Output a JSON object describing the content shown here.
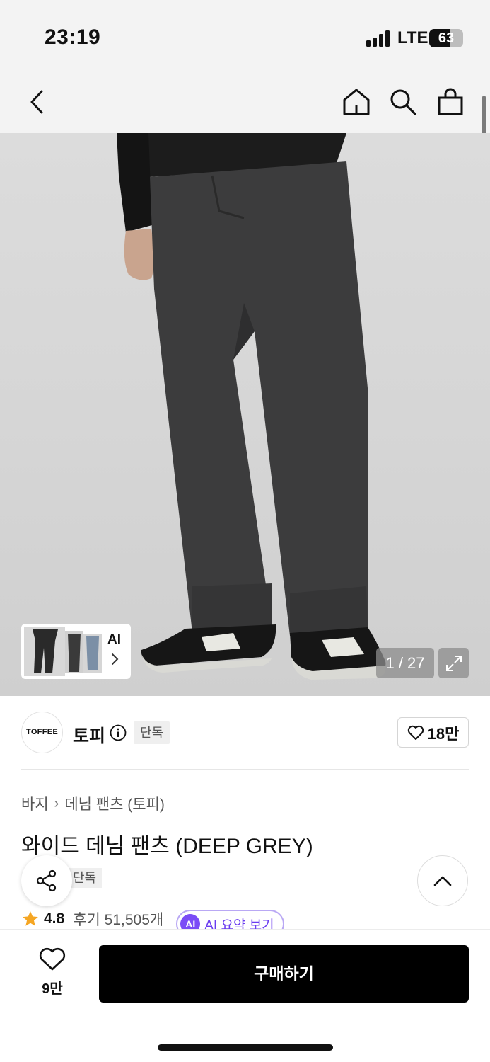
{
  "status_bar": {
    "time": "23:19",
    "network": "LTE",
    "battery_level": "63",
    "battery_fraction": 0.63
  },
  "nav": {
    "back_icon": "chevron-left-icon",
    "home_icon": "home-icon",
    "search_icon": "search-icon",
    "cart_icon": "shopping-bag-icon"
  },
  "gallery": {
    "thumb_ai_label": "AI",
    "counter": "1 / 27",
    "expand_icon": "expand-icon"
  },
  "brand": {
    "logo_text": "TOFFEE",
    "name": "토피",
    "exclusive_label": "단독",
    "likes": "18만"
  },
  "product": {
    "breadcrumb": [
      "바지",
      "데님 팬츠 (토피)"
    ],
    "title": "와이드 데님 팬츠 (DEEP GREY)",
    "tag": "단독",
    "rating": "4.8",
    "review_text": "후기 51,505개",
    "ai_badge": "AI",
    "ai_summary_label": "AI 요약 보기"
  },
  "bottom_bar": {
    "wish_count": "9만",
    "buy_label": "구매하기"
  },
  "colors": {
    "accent_purple": "#7b4cf6",
    "star": "#f5a623",
    "buy_button": "#000000"
  }
}
